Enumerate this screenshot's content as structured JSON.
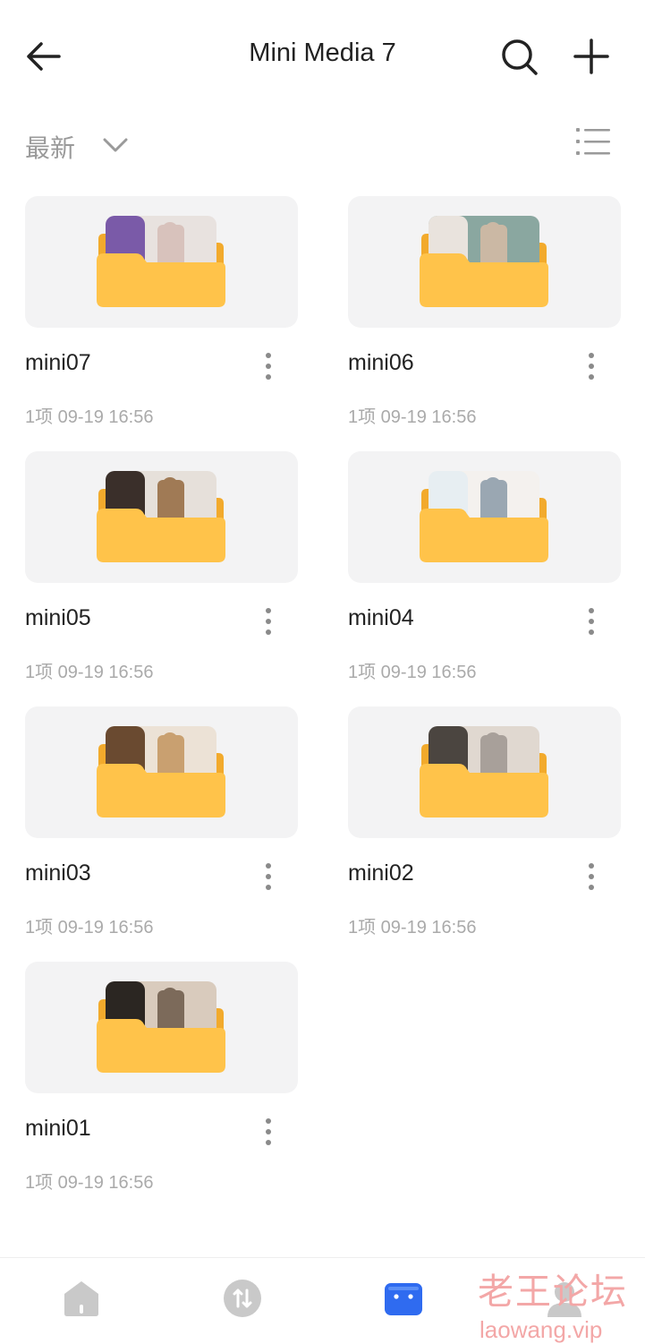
{
  "header": {
    "title": "Mini Media 7"
  },
  "toolbar": {
    "sort_label": "最新"
  },
  "folders": [
    {
      "name": "mini07",
      "meta": "1项  09-19 16:56"
    },
    {
      "name": "mini06",
      "meta": "1项  09-19 16:56"
    },
    {
      "name": "mini05",
      "meta": "1项  09-19 16:56"
    },
    {
      "name": "mini04",
      "meta": "1项  09-19 16:56"
    },
    {
      "name": "mini03",
      "meta": "1项  09-19 16:56"
    },
    {
      "name": "mini02",
      "meta": "1项  09-19 16:56"
    },
    {
      "name": "mini01",
      "meta": "1项  09-19 16:56"
    }
  ],
  "watermark": {
    "cn": "老王论坛",
    "en": "laowang.vip"
  },
  "bottom_nav": [
    {
      "icon": "home-icon"
    },
    {
      "icon": "transfer-icon"
    },
    {
      "icon": "files-icon",
      "active": true
    },
    {
      "icon": "profile-icon"
    }
  ],
  "colors": {
    "folder": "#ffc34a",
    "folder_back": "#f2aa2c",
    "accent": "#2f6bf0",
    "muted": "#aaaaaa"
  }
}
